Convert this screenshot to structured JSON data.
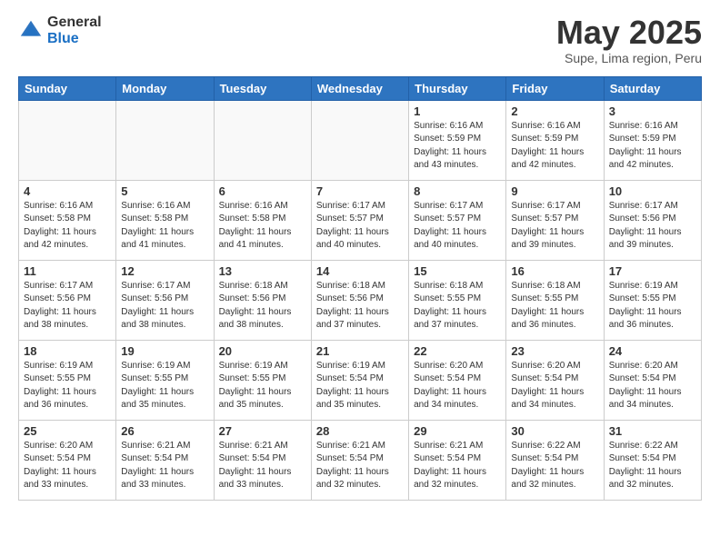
{
  "logo": {
    "general": "General",
    "blue": "Blue"
  },
  "header": {
    "month": "May 2025",
    "location": "Supe, Lima region, Peru"
  },
  "weekdays": [
    "Sunday",
    "Monday",
    "Tuesday",
    "Wednesday",
    "Thursday",
    "Friday",
    "Saturday"
  ],
  "weeks": [
    [
      {
        "day": "",
        "info": ""
      },
      {
        "day": "",
        "info": ""
      },
      {
        "day": "",
        "info": ""
      },
      {
        "day": "",
        "info": ""
      },
      {
        "day": "1",
        "info": "Sunrise: 6:16 AM\nSunset: 5:59 PM\nDaylight: 11 hours and 43 minutes."
      },
      {
        "day": "2",
        "info": "Sunrise: 6:16 AM\nSunset: 5:59 PM\nDaylight: 11 hours and 42 minutes."
      },
      {
        "day": "3",
        "info": "Sunrise: 6:16 AM\nSunset: 5:59 PM\nDaylight: 11 hours and 42 minutes."
      }
    ],
    [
      {
        "day": "4",
        "info": "Sunrise: 6:16 AM\nSunset: 5:58 PM\nDaylight: 11 hours and 42 minutes."
      },
      {
        "day": "5",
        "info": "Sunrise: 6:16 AM\nSunset: 5:58 PM\nDaylight: 11 hours and 41 minutes."
      },
      {
        "day": "6",
        "info": "Sunrise: 6:16 AM\nSunset: 5:58 PM\nDaylight: 11 hours and 41 minutes."
      },
      {
        "day": "7",
        "info": "Sunrise: 6:17 AM\nSunset: 5:57 PM\nDaylight: 11 hours and 40 minutes."
      },
      {
        "day": "8",
        "info": "Sunrise: 6:17 AM\nSunset: 5:57 PM\nDaylight: 11 hours and 40 minutes."
      },
      {
        "day": "9",
        "info": "Sunrise: 6:17 AM\nSunset: 5:57 PM\nDaylight: 11 hours and 39 minutes."
      },
      {
        "day": "10",
        "info": "Sunrise: 6:17 AM\nSunset: 5:56 PM\nDaylight: 11 hours and 39 minutes."
      }
    ],
    [
      {
        "day": "11",
        "info": "Sunrise: 6:17 AM\nSunset: 5:56 PM\nDaylight: 11 hours and 38 minutes."
      },
      {
        "day": "12",
        "info": "Sunrise: 6:17 AM\nSunset: 5:56 PM\nDaylight: 11 hours and 38 minutes."
      },
      {
        "day": "13",
        "info": "Sunrise: 6:18 AM\nSunset: 5:56 PM\nDaylight: 11 hours and 38 minutes."
      },
      {
        "day": "14",
        "info": "Sunrise: 6:18 AM\nSunset: 5:56 PM\nDaylight: 11 hours and 37 minutes."
      },
      {
        "day": "15",
        "info": "Sunrise: 6:18 AM\nSunset: 5:55 PM\nDaylight: 11 hours and 37 minutes."
      },
      {
        "day": "16",
        "info": "Sunrise: 6:18 AM\nSunset: 5:55 PM\nDaylight: 11 hours and 36 minutes."
      },
      {
        "day": "17",
        "info": "Sunrise: 6:19 AM\nSunset: 5:55 PM\nDaylight: 11 hours and 36 minutes."
      }
    ],
    [
      {
        "day": "18",
        "info": "Sunrise: 6:19 AM\nSunset: 5:55 PM\nDaylight: 11 hours and 36 minutes."
      },
      {
        "day": "19",
        "info": "Sunrise: 6:19 AM\nSunset: 5:55 PM\nDaylight: 11 hours and 35 minutes."
      },
      {
        "day": "20",
        "info": "Sunrise: 6:19 AM\nSunset: 5:55 PM\nDaylight: 11 hours and 35 minutes."
      },
      {
        "day": "21",
        "info": "Sunrise: 6:19 AM\nSunset: 5:54 PM\nDaylight: 11 hours and 35 minutes."
      },
      {
        "day": "22",
        "info": "Sunrise: 6:20 AM\nSunset: 5:54 PM\nDaylight: 11 hours and 34 minutes."
      },
      {
        "day": "23",
        "info": "Sunrise: 6:20 AM\nSunset: 5:54 PM\nDaylight: 11 hours and 34 minutes."
      },
      {
        "day": "24",
        "info": "Sunrise: 6:20 AM\nSunset: 5:54 PM\nDaylight: 11 hours and 34 minutes."
      }
    ],
    [
      {
        "day": "25",
        "info": "Sunrise: 6:20 AM\nSunset: 5:54 PM\nDaylight: 11 hours and 33 minutes."
      },
      {
        "day": "26",
        "info": "Sunrise: 6:21 AM\nSunset: 5:54 PM\nDaylight: 11 hours and 33 minutes."
      },
      {
        "day": "27",
        "info": "Sunrise: 6:21 AM\nSunset: 5:54 PM\nDaylight: 11 hours and 33 minutes."
      },
      {
        "day": "28",
        "info": "Sunrise: 6:21 AM\nSunset: 5:54 PM\nDaylight: 11 hours and 32 minutes."
      },
      {
        "day": "29",
        "info": "Sunrise: 6:21 AM\nSunset: 5:54 PM\nDaylight: 11 hours and 32 minutes."
      },
      {
        "day": "30",
        "info": "Sunrise: 6:22 AM\nSunset: 5:54 PM\nDaylight: 11 hours and 32 minutes."
      },
      {
        "day": "31",
        "info": "Sunrise: 6:22 AM\nSunset: 5:54 PM\nDaylight: 11 hours and 32 minutes."
      }
    ]
  ]
}
